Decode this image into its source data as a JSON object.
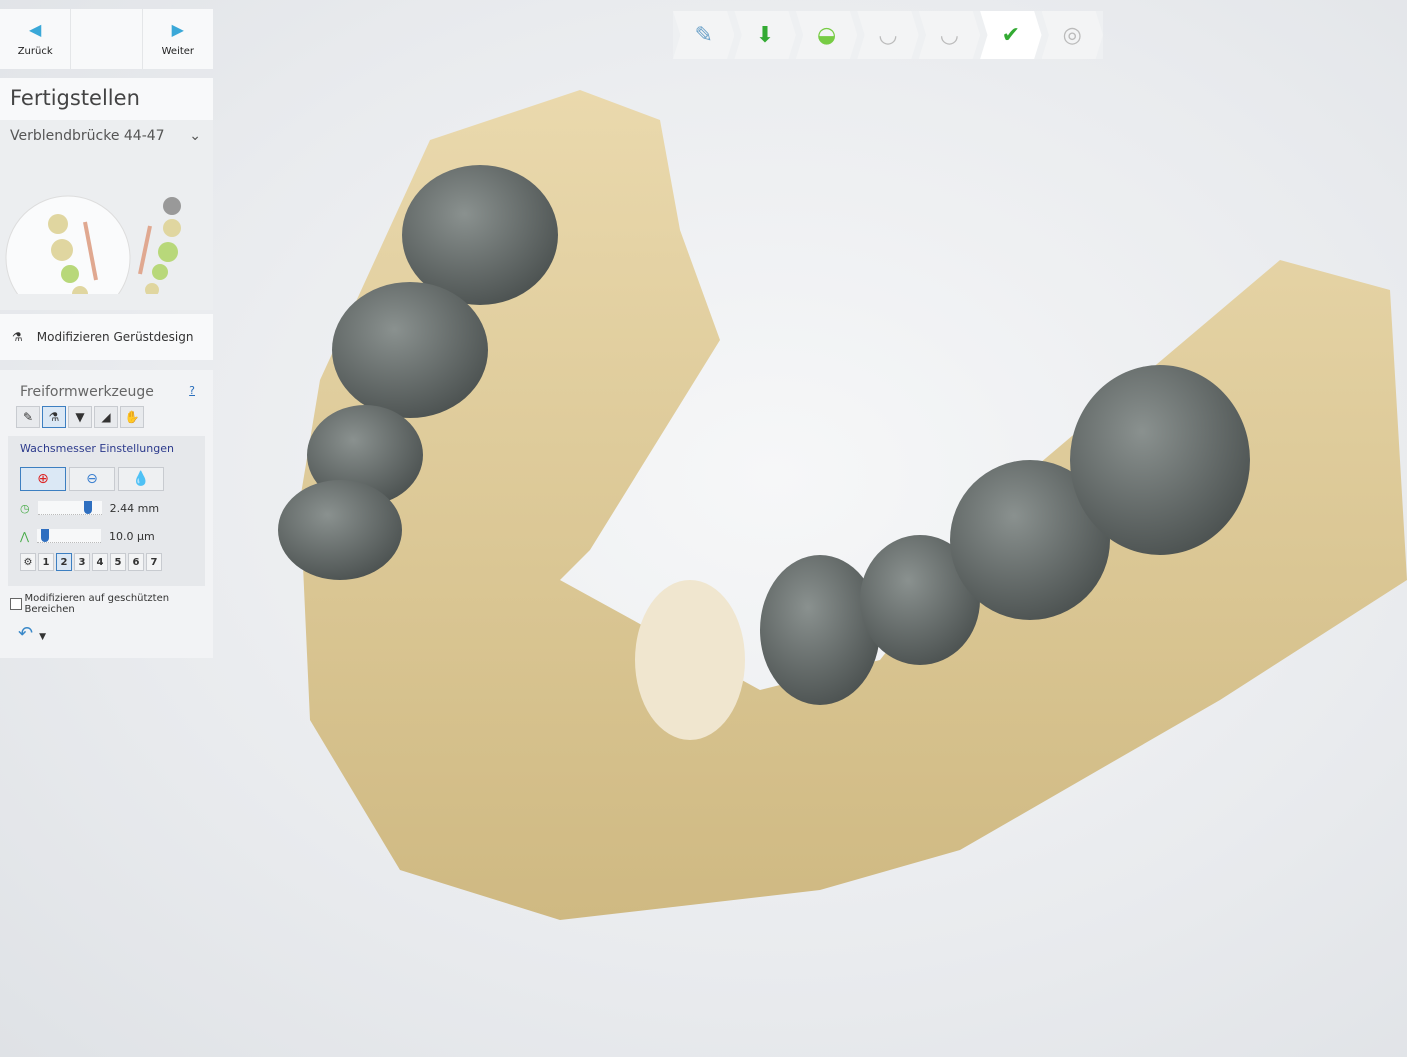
{
  "nav": {
    "back": "Zurück",
    "next": "Weiter"
  },
  "panel_title": "Fertigstellen",
  "restoration_select": "Verblendbrücke 44-47",
  "modify_framework": "Modifizieren Gerüstdesign",
  "freeform": {
    "title": "Freiformwerkzeuge",
    "help": "?",
    "wax_title": "Wachsmesser Einstellungen",
    "size_value": "2.44 mm",
    "size_fraction": 0.78,
    "strength_value": "10.0 µm",
    "strength_fraction": 0.1,
    "presets": [
      "1",
      "2",
      "3",
      "4",
      "5",
      "6",
      "7"
    ],
    "selected_preset": "2",
    "protected_checkbox": "Modifizieren auf geschützten Bereichen"
  },
  "workflow": [
    "administration",
    "model-import",
    "margin",
    "design",
    "finish-design",
    "finalize",
    "export"
  ],
  "colors": {
    "accent": "#3aa8d8",
    "model": "#e2cfa1",
    "crown": "#646b6a"
  }
}
